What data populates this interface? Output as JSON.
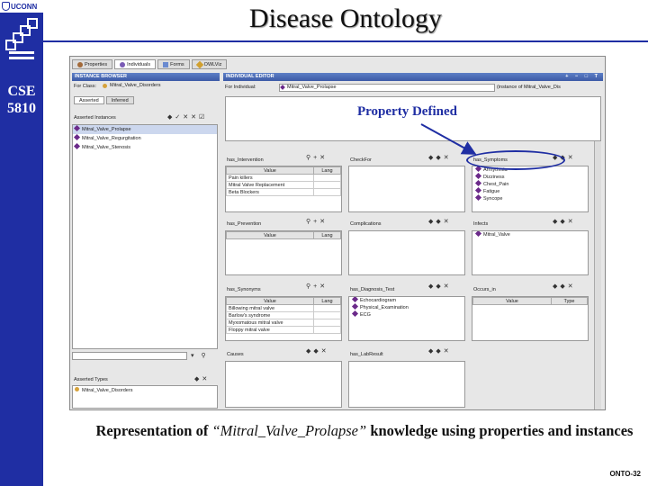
{
  "slide": {
    "university": "UCONN",
    "course_code": "CSE",
    "course_number": "5810",
    "title": "Disease Ontology",
    "annotation": "Property Defined",
    "caption_before": "Representation of",
    "caption_italic": "“Mitral_Valve_Prolapse”",
    "caption_after": "knowledge using properties and instances",
    "slide_id": "ONTO-32",
    "accent_color": "#1f2ea3"
  },
  "app": {
    "tabs": [
      {
        "label": "Properties"
      },
      {
        "label": "Individuals"
      },
      {
        "label": "Forms"
      },
      {
        "label": "OWLViz"
      }
    ],
    "instance_browser": {
      "header": "INSTANCE BROWSER",
      "for_class_label": "For Class:",
      "for_class_value": "Mitral_Valve_Disorders",
      "sub_tabs": [
        "Asserted",
        "Inferred"
      ],
      "asserted_instances_label": "Asserted Instances",
      "instances": [
        "Mitral_Valve_Prolapse",
        "Mitral_Valve_Regurgitation",
        "Mitral_Valve_Stenosis"
      ],
      "asserted_types_label": "Asserted Types",
      "types": [
        "Mitral_Valve_Disorders"
      ]
    },
    "individual_editor": {
      "header": "INDIVIDUAL EDITOR",
      "for_individual_label": "For Individual:",
      "for_individual_value": "Mitral_Valve_Prolapse",
      "type_hint": "(instance of Mitral_Valve_Dis"
    },
    "properties": {
      "has_intervention": {
        "label": "has_Intervention",
        "col_value": "Value",
        "col_lang": "Lang",
        "rows": [
          "Pain killers",
          "Mitral Valve Replacement",
          "Beta Blockers"
        ]
      },
      "check_for": {
        "label": "CheckFor"
      },
      "has_symptoms": {
        "label": "has_Symptoms",
        "items": [
          "Arrhythmia",
          "Dizziness",
          "Chest_Pain",
          "Fatigue",
          "Syncope"
        ]
      },
      "has_prevention": {
        "label": "has_Prevention",
        "col_value": "Value",
        "col_lang": "Lang"
      },
      "complications": {
        "label": "Complications"
      },
      "infects": {
        "label": "Infects",
        "items": [
          "Mitral_Valve"
        ]
      },
      "has_synonyms": {
        "label": "has_Synonyms",
        "col_value": "Value",
        "col_lang": "Lang",
        "rows": [
          "Billowing mitral valve",
          "Barlow's syndrome",
          "Myxomatous mitral valve",
          "Floppy mitral valve"
        ]
      },
      "has_diagnosis_test": {
        "label": "has_Diagnosis_Test",
        "items": [
          "Echocardiogram",
          "Physical_Examination",
          "ECG"
        ]
      },
      "occurs_in": {
        "label": "Occurs_in",
        "col_value": "Value",
        "col_type": "Type"
      },
      "causes": {
        "label": "Causes"
      },
      "has_lab_result": {
        "label": "has_LabResult"
      }
    }
  }
}
